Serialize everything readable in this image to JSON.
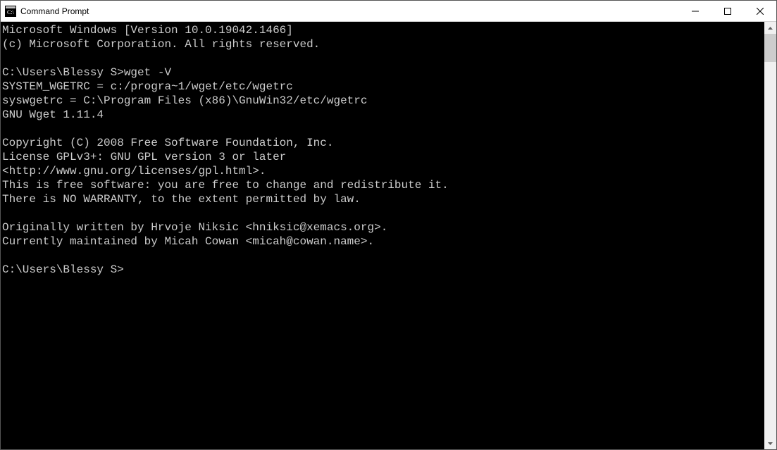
{
  "window": {
    "title": "Command Prompt"
  },
  "terminal": {
    "lines": [
      "Microsoft Windows [Version 10.0.19042.1466]",
      "(c) Microsoft Corporation. All rights reserved.",
      "",
      "C:\\Users\\Blessy S>wget -V",
      "SYSTEM_WGETRC = c:/progra~1/wget/etc/wgetrc",
      "syswgetrc = C:\\Program Files (x86)\\GnuWin32/etc/wgetrc",
      "GNU Wget 1.11.4",
      "",
      "Copyright (C) 2008 Free Software Foundation, Inc.",
      "License GPLv3+: GNU GPL version 3 or later",
      "<http://www.gnu.org/licenses/gpl.html>.",
      "This is free software: you are free to change and redistribute it.",
      "There is NO WARRANTY, to the extent permitted by law.",
      "",
      "Originally written by Hrvoje Niksic <hniksic@xemacs.org>.",
      "Currently maintained by Micah Cowan <micah@cowan.name>.",
      "",
      "C:\\Users\\Blessy S>"
    ]
  }
}
